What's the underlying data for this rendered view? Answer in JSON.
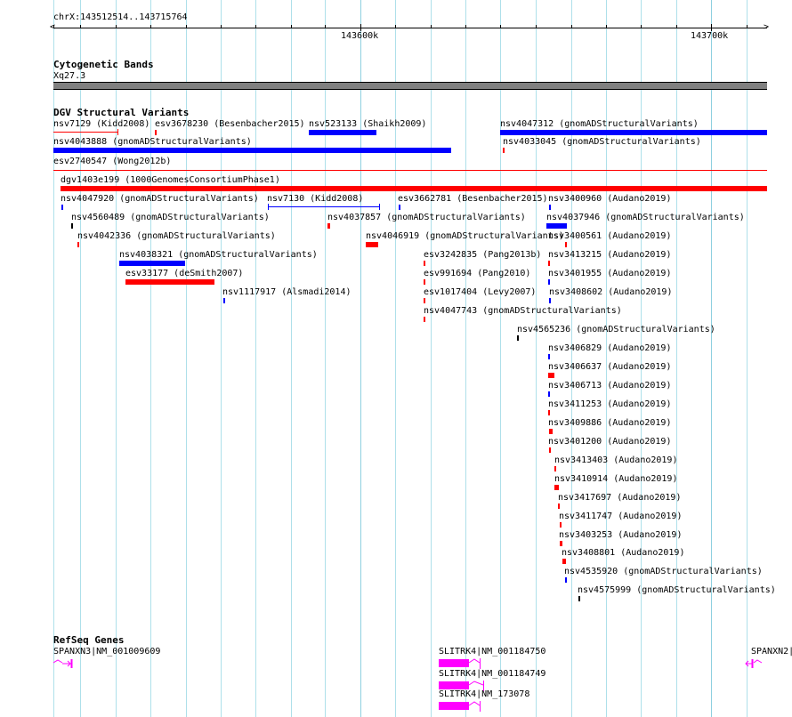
{
  "ruler": {
    "region": "chrX:143512514..143715764",
    "tick_labels": [
      "143600k",
      "143700k"
    ]
  },
  "cytobands": {
    "title": "Cytogenetic Bands",
    "band": "Xq27.3",
    "band_color": "#808080"
  },
  "dgv": {
    "title": "DGV Structural Variants",
    "colors": {
      "loss": "#ff0000",
      "gain": "#0000ff",
      "other": "#000000"
    },
    "features": [
      {
        "label": "nsv7129 (Kidd2008)",
        "color": "#ff0000"
      },
      {
        "label": "esv3678230 (Besenbacher2015)",
        "color": "#ff0000"
      },
      {
        "label": "nsv523133 (Shaikh2009)",
        "color": "#0000ff"
      },
      {
        "label": "nsv4047312 (gnomADStructuralVariants)",
        "color": "#0000ff"
      },
      {
        "label": "nsv4043888 (gnomADStructuralVariants)",
        "color": "#0000ff"
      },
      {
        "label": "nsv4033045 (gnomADStructuralVariants)",
        "color": "#ff0000"
      },
      {
        "label": "esv2740547 (Wong2012b)",
        "color": "#ff0000"
      },
      {
        "label": "dgv1403e199 (1000GenomesConsortiumPhase1)",
        "color": "#ff0000"
      },
      {
        "label": "nsv4047920 (gnomADStructuralVariants)",
        "color": "#0000ff"
      },
      {
        "label": "nsv7130 (Kidd2008)",
        "color": "#0000ff"
      },
      {
        "label": "esv3662781 (Besenbacher2015)",
        "color": "#0000ff"
      },
      {
        "label": "nsv3400960 (Audano2019)",
        "color": "#0000ff"
      },
      {
        "label": "nsv4560489 (gnomADStructuralVariants)",
        "color": "#000000"
      },
      {
        "label": "nsv4037857 (gnomADStructuralVariants)",
        "color": "#ff0000"
      },
      {
        "label": "nsv4037946 (gnomADStructuralVariants)",
        "color": "#0000ff"
      },
      {
        "label": "nsv4042336 (gnomADStructuralVariants)",
        "color": "#ff0000"
      },
      {
        "label": "nsv4046919 (gnomADStructuralVariants)",
        "color": "#ff0000"
      },
      {
        "label": "nsv3400561 (Audano2019)",
        "color": "#ff0000"
      },
      {
        "label": "nsv4038321 (gnomADStructuralVariants)",
        "color": "#0000ff"
      },
      {
        "label": "esv3242835 (Pang2013b)",
        "color": "#ff0000"
      },
      {
        "label": "nsv3413215 (Audano2019)",
        "color": "#ff0000"
      },
      {
        "label": "esv33177 (deSmith2007)",
        "color": "#ff0000"
      },
      {
        "label": "esv991694 (Pang2010)",
        "color": "#ff0000"
      },
      {
        "label": "nsv3401955 (Audano2019)",
        "color": "#0000ff"
      },
      {
        "label": "nsv1117917 (Alsmadi2014)",
        "color": "#0000ff"
      },
      {
        "label": "esv1017404 (Levy2007)",
        "color": "#ff0000"
      },
      {
        "label": "nsv3408602 (Audano2019)",
        "color": "#0000ff"
      },
      {
        "label": "nsv4047743 (gnomADStructuralVariants)",
        "color": "#ff0000"
      },
      {
        "label": "nsv4565236 (gnomADStructuralVariants)",
        "color": "#000000"
      },
      {
        "label": "nsv3406829 (Audano2019)",
        "color": "#0000ff"
      },
      {
        "label": "nsv3406637 (Audano2019)",
        "color": "#ff0000"
      },
      {
        "label": "nsv3406713 (Audano2019)",
        "color": "#0000ff"
      },
      {
        "label": "nsv3411253 (Audano2019)",
        "color": "#ff0000"
      },
      {
        "label": "nsv3409886 (Audano2019)",
        "color": "#ff0000"
      },
      {
        "label": "nsv3401200 (Audano2019)",
        "color": "#ff0000"
      },
      {
        "label": "nsv3413403 (Audano2019)",
        "color": "#ff0000"
      },
      {
        "label": "nsv3410914 (Audano2019)",
        "color": "#ff0000"
      },
      {
        "label": "nsv3417697 (Audano2019)",
        "color": "#ff0000"
      },
      {
        "label": "nsv3411747 (Audano2019)",
        "color": "#ff0000"
      },
      {
        "label": "nsv3403253 (Audano2019)",
        "color": "#ff0000"
      },
      {
        "label": "nsv3408801 (Audano2019)",
        "color": "#ff0000"
      },
      {
        "label": "nsv4535920 (gnomADStructuralVariants)",
        "color": "#0000ff"
      },
      {
        "label": "nsv4575999 (gnomADStructuralVariants)",
        "color": "#000000"
      }
    ]
  },
  "refseq": {
    "title": "RefSeq Genes",
    "color": "#ff00ff",
    "genes": [
      {
        "label": "SPANXN3|NM_001009609"
      },
      {
        "label": "SLITRK4|NM_001184750"
      },
      {
        "label": "SLITRK4|NM_001184749"
      },
      {
        "label": "SLITRK4|NM_173078"
      },
      {
        "label": "SPANXN2|"
      }
    ]
  }
}
